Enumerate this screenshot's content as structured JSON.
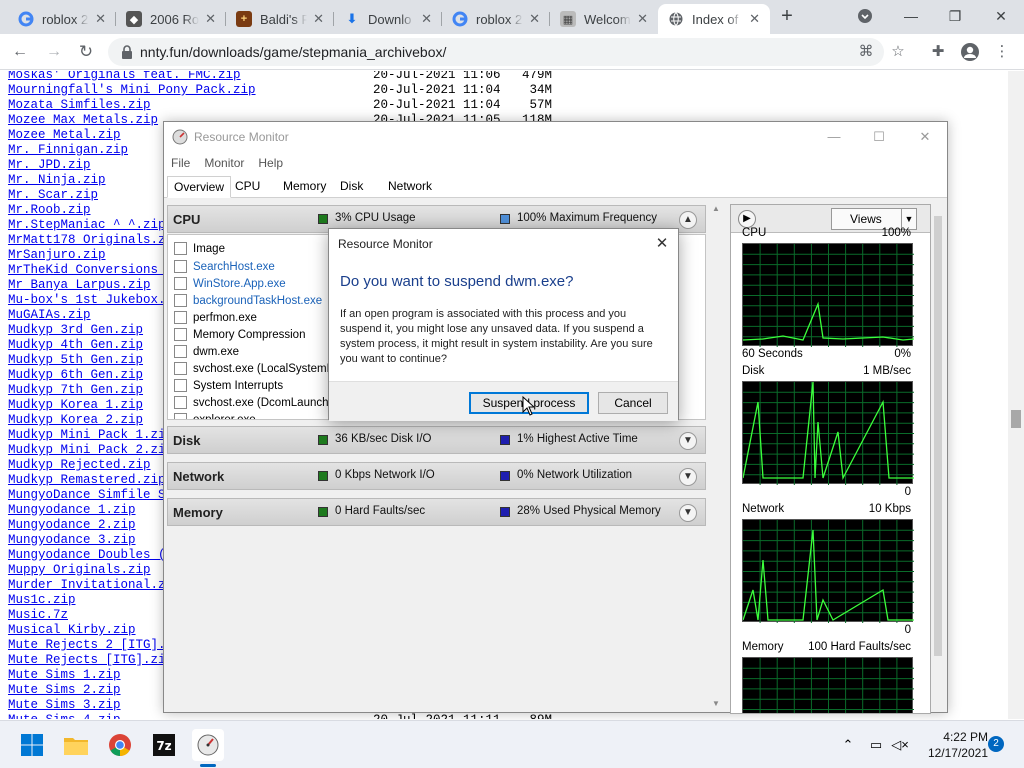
{
  "browser": {
    "tabs": [
      {
        "label": "roblox 2",
        "icon": "google-icon"
      },
      {
        "label": "2006 Ro",
        "icon": "roblox-icon"
      },
      {
        "label": "Baldi's F",
        "icon": "baldi-icon"
      },
      {
        "label": "Downlo",
        "icon": "download-icon"
      },
      {
        "label": "roblox 2",
        "icon": "google-icon"
      },
      {
        "label": "Welcom",
        "icon": "welcome-icon"
      },
      {
        "label": "Index of",
        "icon": "globe-icon"
      }
    ],
    "url": "nnty.fun/downloads/game/stepmania_archivebox/",
    "accent": "#1a73e8"
  },
  "listing": [
    {
      "name": "Moskas' Originals feat. FMC.zip",
      "date": "20-Jul-2021 11:06",
      "size": "479M"
    },
    {
      "name": "Mourningfall's Mini Pony Pack.zip",
      "date": "20-Jul-2021 11:04",
      "size": "34M"
    },
    {
      "name": "Mozata Simfiles.zip",
      "date": "20-Jul-2021 11:04",
      "size": "57M"
    },
    {
      "name": "Mozee Max Metals.zip",
      "date": "20-Jul-2021 11:05",
      "size": "118M"
    },
    {
      "name": "Mozee Metal.zip",
      "date": "",
      "size": ""
    },
    {
      "name": "Mr. Finnigan.zip",
      "date": "",
      "size": ""
    },
    {
      "name": "Mr. JPD.zip",
      "date": "",
      "size": ""
    },
    {
      "name": "Mr. Ninja.zip",
      "date": "",
      "size": ""
    },
    {
      "name": "Mr. Scar.zip",
      "date": "",
      "size": ""
    },
    {
      "name": "Mr.Roob.zip",
      "date": "",
      "size": ""
    },
    {
      "name": "Mr.StepManiac ^_^.zip",
      "date": "",
      "size": ""
    },
    {
      "name": "MrMatt178 Originals.zi",
      "date": "",
      "size": ""
    },
    {
      "name": "MrSanjuro.zip",
      "date": "",
      "size": ""
    },
    {
      "name": "MrTheKid Conversions [",
      "date": "",
      "size": ""
    },
    {
      "name": "Mr_Banya_Larpus.zip",
      "date": "",
      "size": ""
    },
    {
      "name": "Mu-box's 1st Jukebox.z",
      "date": "",
      "size": ""
    },
    {
      "name": "MuGAIAs.zip",
      "date": "",
      "size": ""
    },
    {
      "name": "Mudkyp 3rd Gen.zip",
      "date": "",
      "size": ""
    },
    {
      "name": "Mudkyp 4th Gen.zip",
      "date": "",
      "size": ""
    },
    {
      "name": "Mudkyp 5th Gen.zip",
      "date": "",
      "size": ""
    },
    {
      "name": "Mudkyp 6th Gen.zip",
      "date": "",
      "size": ""
    },
    {
      "name": "Mudkyp 7th Gen.zip",
      "date": "",
      "size": ""
    },
    {
      "name": "Mudkyp Korea 1.zip",
      "date": "",
      "size": ""
    },
    {
      "name": "Mudkyp Korea 2.zip",
      "date": "",
      "size": ""
    },
    {
      "name": "Mudkyp Mini Pack 1.zip",
      "date": "",
      "size": ""
    },
    {
      "name": "Mudkyp Mini Pack 2.zip",
      "date": "",
      "size": ""
    },
    {
      "name": "Mudkyp Rejected.zip",
      "date": "",
      "size": ""
    },
    {
      "name": "Mudkyp Remastered.zip",
      "date": "",
      "size": ""
    },
    {
      "name": "MungyoDance Simfile Se",
      "date": "",
      "size": ""
    },
    {
      "name": "Mungyodance 1.zip",
      "date": "",
      "size": ""
    },
    {
      "name": "Mungyodance 2.zip",
      "date": "",
      "size": ""
    },
    {
      "name": "Mungyodance 3.zip",
      "date": "",
      "size": ""
    },
    {
      "name": "Mungyodance Doubles (W",
      "date": "",
      "size": ""
    },
    {
      "name": "Muppy Originals.zip",
      "date": "",
      "size": ""
    },
    {
      "name": "Murder Invitational.zi",
      "date": "",
      "size": ""
    },
    {
      "name": "Mus1c.zip",
      "date": "",
      "size": ""
    },
    {
      "name": "Music.7z",
      "date": "",
      "size": ""
    },
    {
      "name": "Musical Kirby.zip",
      "date": "",
      "size": ""
    },
    {
      "name": "Mute Rejects 2 [ITG].z",
      "date": "",
      "size": ""
    },
    {
      "name": "Mute Rejects [ITG].zip",
      "date": "",
      "size": ""
    },
    {
      "name": "Mute Sims 1.zip",
      "date": "",
      "size": ""
    },
    {
      "name": "Mute Sims 2.zip",
      "date": "",
      "size": ""
    },
    {
      "name": "Mute Sims 3.zip",
      "date": "",
      "size": ""
    },
    {
      "name": "Mute Sims 4.zip",
      "date": "20-Jul-2021 11:11",
      "size": "89M"
    }
  ],
  "resmon": {
    "title": "Resource Monitor",
    "menu": [
      "File",
      "Monitor",
      "Help"
    ],
    "tabs": [
      "Overview",
      "CPU",
      "Memory",
      "Disk",
      "Network"
    ],
    "sections": [
      {
        "name": "CPU",
        "stat1": "3% CPU Usage",
        "stat2": "100% Maximum Frequency",
        "color1": "#1e7a1e",
        "color2": "#4f8fd8"
      },
      {
        "name": "Disk",
        "stat1": "36 KB/sec Disk I/O",
        "stat2": "1% Highest Active Time",
        "color1": "#1e7a1e",
        "color2": "#1f1fb0"
      },
      {
        "name": "Network",
        "stat1": "0 Kbps Network I/O",
        "stat2": "0% Network Utilization",
        "color1": "#1e7a1e",
        "color2": "#1f1fb0"
      },
      {
        "name": "Memory",
        "stat1": "0 Hard Faults/sec",
        "stat2": "28% Used Physical Memory",
        "color1": "#1e7a1e",
        "color2": "#1f1fb0"
      }
    ],
    "image_header": "Image",
    "processes": [
      {
        "name": "SearchHost.exe",
        "svc": true
      },
      {
        "name": "WinStore.App.exe",
        "svc": true
      },
      {
        "name": "backgroundTaskHost.exe",
        "svc": true
      },
      {
        "name": "perfmon.exe",
        "svc": false
      },
      {
        "name": "Memory Compression",
        "svc": false
      },
      {
        "name": "dwm.exe",
        "svc": false
      },
      {
        "name": "svchost.exe (LocalSystemNet",
        "svc": false
      },
      {
        "name": "System Interrupts",
        "svc": false
      },
      {
        "name": "svchost.exe (DcomLaunch -p",
        "svc": false
      },
      {
        "name": "explorer.exe",
        "svc": false
      }
    ],
    "views_label": "Views",
    "graphs": [
      {
        "label": "CPU",
        "right": "100%",
        "bl": "60 Seconds",
        "br": "0%"
      },
      {
        "label": "Disk",
        "right": "1 MB/sec",
        "bl": "",
        "br": "0"
      },
      {
        "label": "Network",
        "right": "10 Kbps",
        "bl": "",
        "br": "0"
      },
      {
        "label": "Memory",
        "right": "100 Hard Faults/sec",
        "bl": "",
        "br": ""
      }
    ]
  },
  "dialog": {
    "title": "Resource Monitor",
    "heading": "Do you want to suspend dwm.exe?",
    "body": "If an open program is associated with this process and you suspend it, you might lose any unsaved data. If you suspend a system process, it might result in system instability. Are you sure you want to continue?",
    "primary": "Suspend process",
    "cancel": "Cancel"
  },
  "taskbar": {
    "time": "4:22 PM",
    "date": "12/17/2021",
    "notifications": "2"
  }
}
